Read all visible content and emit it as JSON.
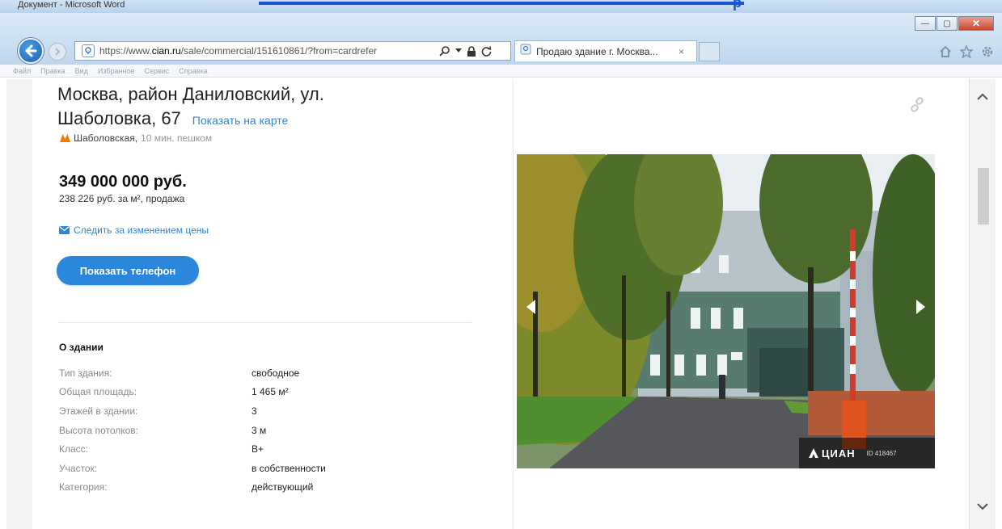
{
  "window": {
    "doc_title": "Документ - Microsoft Word",
    "banner_letter": "р",
    "controls": {
      "minimize": "—",
      "maximize": "▢",
      "close": "✕"
    }
  },
  "browser": {
    "url_prefix": "https://www.",
    "url_domain": "cian.ru",
    "url_rest": "/sale/commercial/151610861/?from=cardrefer",
    "tab_title": "Продаю здание г. Москва...",
    "tab_close": "×",
    "menu": [
      "Файл",
      "Правка",
      "Вид",
      "Избранное",
      "Сервис",
      "Справка"
    ]
  },
  "listing": {
    "address_line1": "Москва, район Даниловский, ул.",
    "address_line2": "Шаболовка, 67",
    "map_link": "Показать на карте",
    "metro_station": "Шаболовская,",
    "metro_walk": "10 мин. пешком",
    "price": "349 000 000 руб.",
    "price_per_m2": "238 226 руб. за м², продажа",
    "watch_price": "Следить за изменением цены",
    "show_phone": "Показать телефон",
    "section_title": "О здании",
    "specs": [
      {
        "key": "Тип здания:",
        "value": "свободное"
      },
      {
        "key": "Общая площадь:",
        "value": "1 465 м²"
      },
      {
        "key": "Этажей в здании:",
        "value": "3"
      },
      {
        "key": "Высота потолков:",
        "value": "3 м"
      },
      {
        "key": "Класс:",
        "value": "B+"
      },
      {
        "key": "Участок:",
        "value": "в собственности"
      },
      {
        "key": "Категория:",
        "value": "действующий"
      }
    ]
  },
  "photo": {
    "brand": "ЦИАН",
    "photo_id": "ID 418467"
  },
  "colors": {
    "accent": "#2b87db",
    "metro_icon": "#f07d00"
  }
}
